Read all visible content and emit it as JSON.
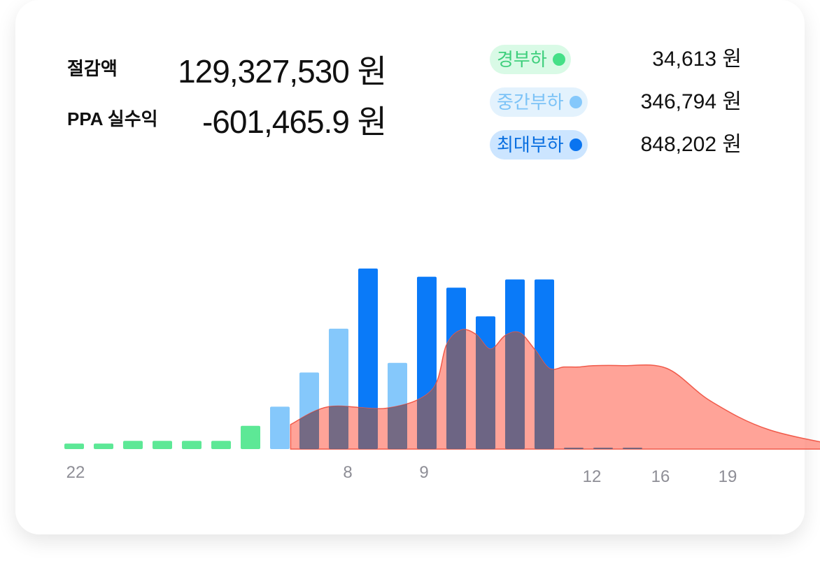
{
  "summary": {
    "savings_label": "절감액",
    "savings_value": "129,327,530 원",
    "ppa_label": "PPA 실수익",
    "ppa_value": "-601,465.9 원"
  },
  "legend": [
    {
      "name": "경부하",
      "value": "34,613 원",
      "text_color": "#3ecf7c",
      "bg_color": "#d9fae6",
      "dot_color": "#45e087"
    },
    {
      "name": "중간부하",
      "value": "346,794 원",
      "text_color": "#7cc3f7",
      "bg_color": "#e3f2fd",
      "dot_color": "#85c8fb"
    },
    {
      "name": "최대부하",
      "value": "848,202 원",
      "text_color": "#0a6fe0",
      "bg_color": "#cce5ff",
      "dot_color": "#0a74f0"
    }
  ],
  "chart_data": {
    "type": "bar",
    "x_tick_labels": [
      "22",
      "8",
      "9",
      "12",
      "16",
      "19"
    ],
    "ylim": [
      0,
      270
    ],
    "series": [
      {
        "name": "경부하",
        "color": "#5de896",
        "values": [
          8,
          8,
          12,
          12,
          12,
          12,
          34,
          0,
          0,
          0,
          0,
          0,
          0,
          0,
          0,
          0,
          0,
          0,
          0,
          0
        ]
      },
      {
        "name": "중간부하",
        "color": "#85c8fb",
        "values": [
          0,
          0,
          0,
          0,
          0,
          0,
          0,
          62,
          112,
          176,
          0,
          126,
          0,
          0,
          0,
          0,
          0,
          2,
          2,
          2
        ]
      },
      {
        "name": "최대부하",
        "color": "#0a7af8",
        "values": [
          0,
          0,
          0,
          0,
          0,
          0,
          0,
          0,
          0,
          0,
          264,
          0,
          252,
          236,
          194,
          248,
          248,
          0,
          0,
          0
        ]
      }
    ],
    "area": {
      "color": "#ff8070",
      "x": [
        7.7,
        9,
        11,
        12.5,
        13,
        13.5,
        14,
        14.5,
        15,
        15.5,
        16,
        16.5,
        17,
        17.5,
        18,
        19,
        20.5,
        22,
        24,
        27
      ],
      "values": [
        36,
        62,
        60,
        86,
        152,
        174,
        168,
        146,
        166,
        170,
        146,
        118,
        120,
        120,
        122,
        122,
        118,
        70,
        28,
        0
      ]
    }
  }
}
